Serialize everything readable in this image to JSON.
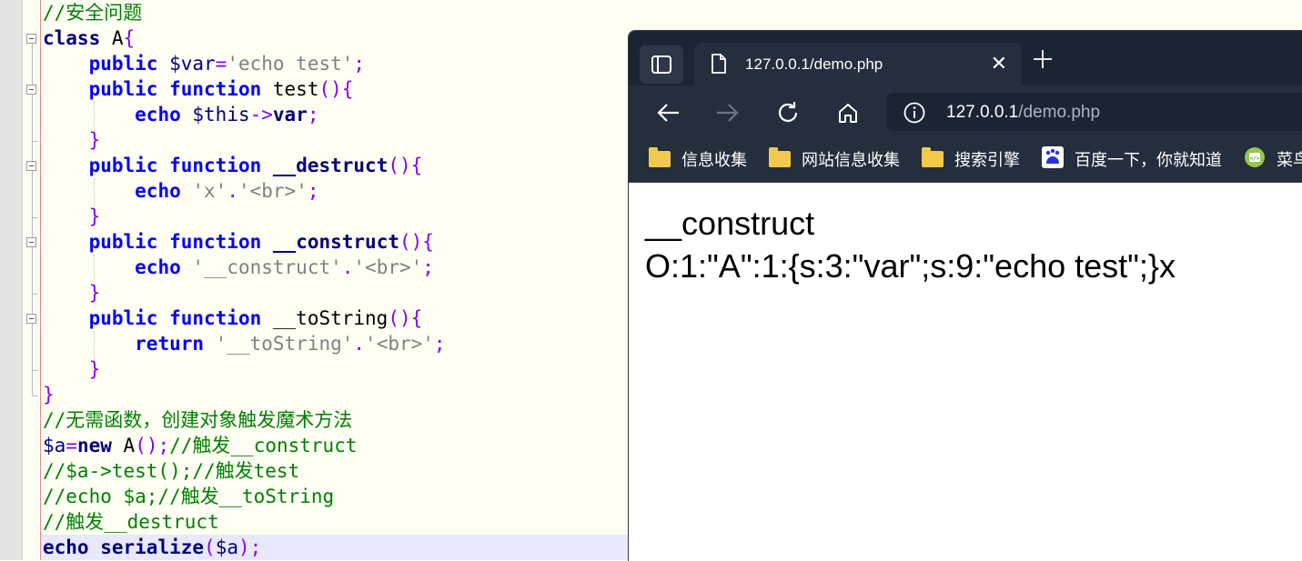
{
  "editor": {
    "lines": [
      [
        [
          "cm",
          "//安全问题"
        ]
      ],
      [
        [
          "kwb",
          "class"
        ],
        [
          "pl",
          " A"
        ],
        [
          "op",
          "{"
        ]
      ],
      [
        [
          "pl",
          "    "
        ],
        [
          "kw",
          "public"
        ],
        [
          "pl",
          " "
        ],
        [
          "vr",
          "$var"
        ],
        [
          "op",
          "="
        ],
        [
          "st",
          "'echo test'"
        ],
        [
          "op",
          ";"
        ]
      ],
      [
        [
          "pl",
          "    "
        ],
        [
          "kw",
          "public"
        ],
        [
          "pl",
          " "
        ],
        [
          "kw",
          "function"
        ],
        [
          "pl",
          " test"
        ],
        [
          "op",
          "(){"
        ]
      ],
      [
        [
          "pl",
          "        "
        ],
        [
          "kw",
          "echo"
        ],
        [
          "pl",
          " "
        ],
        [
          "vr",
          "$this"
        ],
        [
          "op",
          "->"
        ],
        [
          "kwb",
          "var"
        ],
        [
          "op",
          ";"
        ]
      ],
      [
        [
          "pl",
          "    "
        ],
        [
          "op",
          "}"
        ]
      ],
      [
        [
          "pl",
          "    "
        ],
        [
          "kw",
          "public"
        ],
        [
          "pl",
          " "
        ],
        [
          "kw",
          "function"
        ],
        [
          "pl",
          " "
        ],
        [
          "kwb",
          "__destruct"
        ],
        [
          "op",
          "(){"
        ]
      ],
      [
        [
          "pl",
          "        "
        ],
        [
          "kw",
          "echo"
        ],
        [
          "pl",
          " "
        ],
        [
          "st",
          "'x'"
        ],
        [
          "op",
          "."
        ],
        [
          "st",
          "'<br>'"
        ],
        [
          "op",
          ";"
        ]
      ],
      [
        [
          "pl",
          "    "
        ],
        [
          "op",
          "}"
        ]
      ],
      [
        [
          "pl",
          "    "
        ],
        [
          "kw",
          "public"
        ],
        [
          "pl",
          " "
        ],
        [
          "kw",
          "function"
        ],
        [
          "pl",
          " "
        ],
        [
          "kwb",
          "__construct"
        ],
        [
          "op",
          "(){"
        ]
      ],
      [
        [
          "pl",
          "        "
        ],
        [
          "kw",
          "echo"
        ],
        [
          "pl",
          " "
        ],
        [
          "st",
          "'__construct'"
        ],
        [
          "op",
          "."
        ],
        [
          "st",
          "'<br>'"
        ],
        [
          "op",
          ";"
        ]
      ],
      [
        [
          "pl",
          "    "
        ],
        [
          "op",
          "}"
        ]
      ],
      [
        [
          "pl",
          "    "
        ],
        [
          "kw",
          "public"
        ],
        [
          "pl",
          " "
        ],
        [
          "kw",
          "function"
        ],
        [
          "pl",
          " __toString"
        ],
        [
          "op",
          "(){"
        ]
      ],
      [
        [
          "pl",
          "        "
        ],
        [
          "kw",
          "return"
        ],
        [
          "pl",
          " "
        ],
        [
          "st",
          "'__toString'"
        ],
        [
          "op",
          "."
        ],
        [
          "st",
          "'<br>'"
        ],
        [
          "op",
          ";"
        ]
      ],
      [
        [
          "pl",
          "    "
        ],
        [
          "op",
          "}"
        ]
      ],
      [
        [
          "op",
          "}"
        ]
      ],
      [
        [
          "cm",
          "//无需函数，创建对象触发魔术方法"
        ]
      ],
      [
        [
          "vr",
          "$a"
        ],
        [
          "op",
          "="
        ],
        [
          "kwb",
          "new"
        ],
        [
          "pl",
          " A"
        ],
        [
          "op",
          "();"
        ],
        [
          "cm",
          "//触发__construct"
        ]
      ],
      [
        [
          "cm",
          "//$a->test();//触发test"
        ]
      ],
      [
        [
          "cm",
          "//echo $a;//触发__toString"
        ]
      ],
      [
        [
          "cm",
          "//触发__destruct"
        ]
      ],
      [
        [
          "kwb",
          "echo"
        ],
        [
          "pl",
          " "
        ],
        [
          "kwb",
          "serialize"
        ],
        [
          "op",
          "("
        ],
        [
          "vr",
          "$a"
        ],
        [
          "op",
          ");"
        ]
      ]
    ]
  },
  "browser": {
    "tab_title": "127.0.0.1/demo.php",
    "url_host": "127.0.0.1",
    "url_path": "/demo.php",
    "bookmarks": [
      {
        "label": "信息收集",
        "icon": "folder-icon"
      },
      {
        "label": "网站信息收集",
        "icon": "folder-icon"
      },
      {
        "label": "搜索引擎",
        "icon": "folder-icon"
      },
      {
        "label": "百度一下，你就知道",
        "icon": "baidu-icon"
      },
      {
        "label": "菜鸟",
        "icon": "runoob-icon"
      }
    ],
    "output_line1": "__construct",
    "output_line2": "O:1:\"A\":1:{s:3:\"var\";s:9:\"echo test\";}x"
  },
  "colors": {
    "comment": "#008000",
    "keyword": "#0000ff",
    "string": "#808080",
    "operator": "#8000ff",
    "browser_dark": "#1b2433",
    "browser_mid": "#242e3d"
  }
}
